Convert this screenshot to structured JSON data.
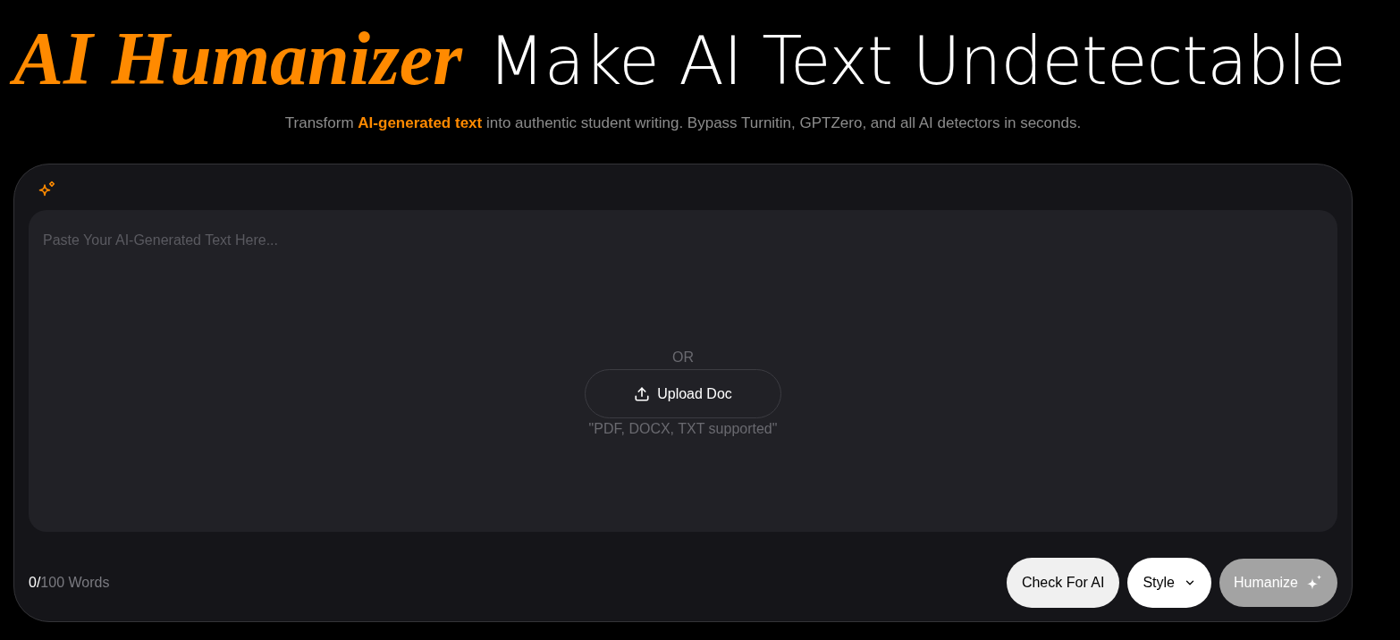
{
  "header": {
    "title_accent": "AI Humanizer",
    "title_rest": "Make AI Text Undetectable",
    "subtitle": "Transform **AI-generated text** into authentic student writing. Bypass Turnitin, GPTZero, and all AI detectors in seconds."
  },
  "editor": {
    "placeholder": "Paste Your AI-Generated Text Here...",
    "divider_text": "OR",
    "upload_button": "Upload Doc",
    "upload_hint": "\"PDF, DOCX, TXT supported\""
  },
  "footer": {
    "word_count": {
      "current": "0/",
      "limit": "100 Words"
    },
    "actions": [
      {
        "kind": "check",
        "label": "Check For AI",
        "disabled": false
      },
      {
        "kind": "dropdown",
        "label": "Style",
        "disabled": false
      },
      {
        "kind": "primary",
        "label": "Humanize",
        "disabled": true
      }
    ]
  }
}
